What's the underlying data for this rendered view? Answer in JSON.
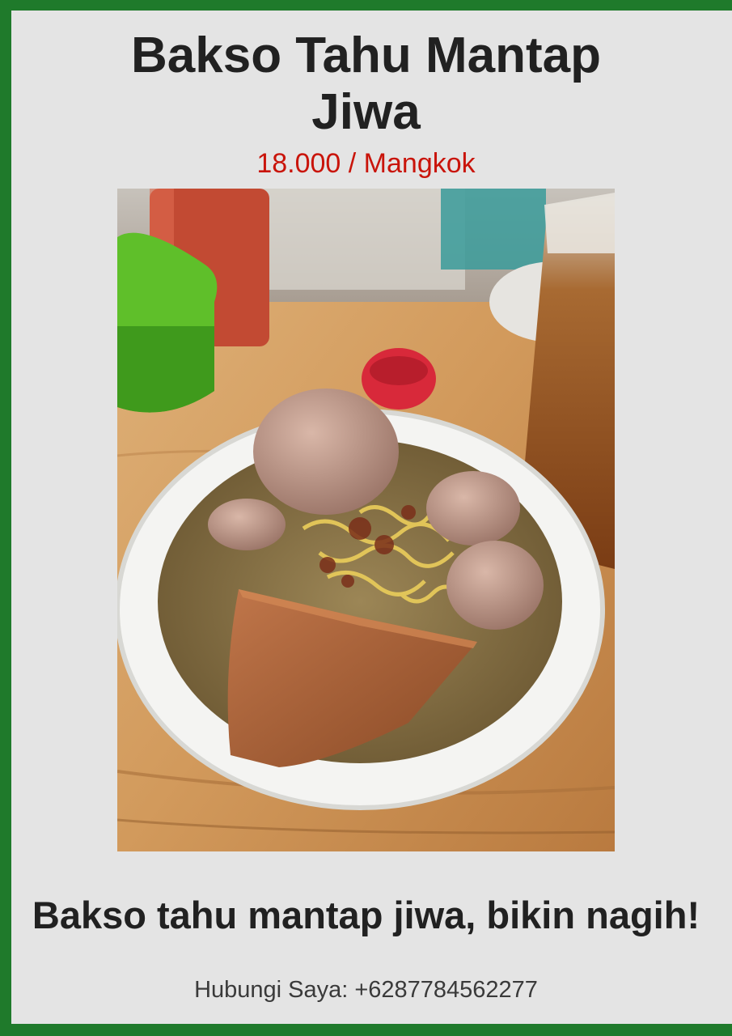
{
  "menu": {
    "title_line1": "Bakso Tahu Mantap",
    "title_line2": "Jiwa",
    "price": "18.000 / Mangkok",
    "tagline": "Bakso tahu mantap jiwa, bikin nagih!",
    "contact_label": "Hubungi Saya:",
    "contact_phone": "+6287784562277"
  },
  "colors": {
    "frame": "#1f7a2b",
    "background": "#e4e4e4",
    "price": "#c9140a",
    "text": "#212121"
  }
}
